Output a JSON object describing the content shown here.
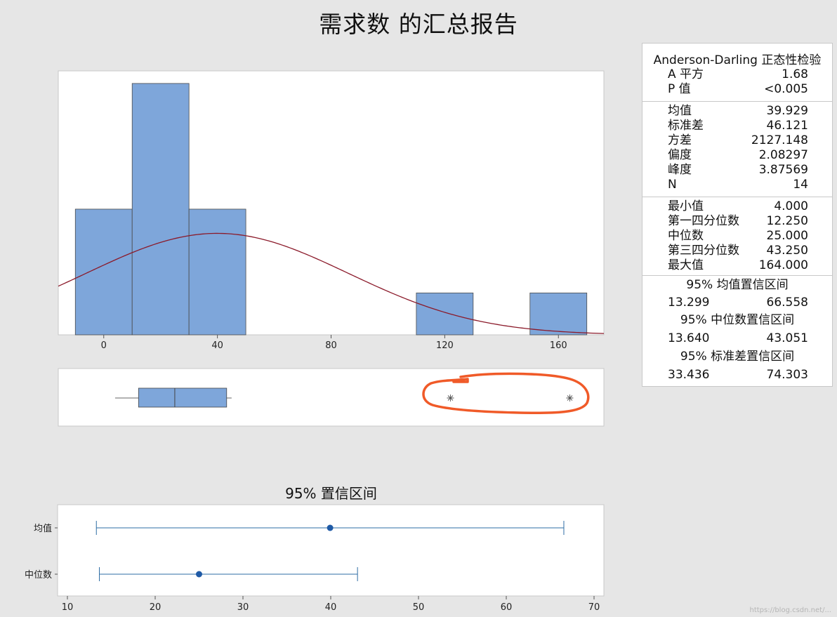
{
  "title": "需求数 的汇总报告",
  "colors": {
    "bar_fill": "#7ea6da",
    "bar_stroke": "#4a4a4a",
    "curve": "#8b1a2a",
    "ci": "#2e6da4",
    "ci_dot": "#1f5aa6",
    "annotation": "#f05a28"
  },
  "stats": {
    "anderson_title": "Anderson-Darling 正态性检验",
    "group1": [
      {
        "label": "A 平方",
        "value": "1.68"
      },
      {
        "label": "P 值",
        "value": "<0.005"
      }
    ],
    "group2": [
      {
        "label": "均值",
        "value": "39.929"
      },
      {
        "label": "标准差",
        "value": "46.121"
      },
      {
        "label": "方差",
        "value": "2127.148"
      },
      {
        "label": "偏度",
        "value": "2.08297"
      },
      {
        "label": "峰度",
        "value": "3.87569"
      },
      {
        "label": "N",
        "value": "14"
      }
    ],
    "group3": [
      {
        "label": "最小值",
        "value": "4.000"
      },
      {
        "label": "第一四分位数",
        "value": "12.250"
      },
      {
        "label": "中位数",
        "value": "25.000"
      },
      {
        "label": "第三四分位数",
        "value": "43.250"
      },
      {
        "label": "最大值",
        "value": "164.000"
      }
    ],
    "ci_mean": {
      "title": "95% 均值置信区间",
      "lo": "13.299",
      "hi": "66.558"
    },
    "ci_median": {
      "title": "95% 中位数置信区间",
      "lo": "13.640",
      "hi": "43.051"
    },
    "ci_stdev": {
      "title": "95% 标准差置信区间",
      "lo": "33.436",
      "hi": "74.303"
    }
  },
  "ci_panel_title": "95% 置信区间",
  "watermark": "https://blog.csdn.net/...",
  "chart_data": [
    {
      "type": "bar",
      "name": "histogram",
      "bins": [
        {
          "from": -10,
          "to": 10,
          "count": 3
        },
        {
          "from": 10,
          "to": 30,
          "count": 6
        },
        {
          "from": 30,
          "to": 50,
          "count": 3
        },
        {
          "from": 50,
          "to": 70,
          "count": 0
        },
        {
          "from": 70,
          "to": 90,
          "count": 0
        },
        {
          "from": 90,
          "to": 110,
          "count": 0
        },
        {
          "from": 110,
          "to": 130,
          "count": 1
        },
        {
          "from": 130,
          "to": 150,
          "count": 0
        },
        {
          "from": 150,
          "to": 170,
          "count": 1
        }
      ],
      "normal_fit": {
        "mean": 39.929,
        "stdev": 46.121,
        "n": 14,
        "bin_width": 20
      },
      "xticks": [
        0,
        40,
        80,
        120,
        160
      ],
      "xlim": [
        -16,
        176
      ],
      "ylim": [
        0,
        6.3
      ]
    },
    {
      "type": "boxplot",
      "min_whisker": 4,
      "q1": 12.25,
      "median": 25,
      "q3": 43.25,
      "max_whisker": 45,
      "outliers": [
        122,
        164
      ],
      "xlim": [
        -16,
        176
      ]
    },
    {
      "type": "interval",
      "title": "95% 置信区间",
      "intervals": [
        {
          "label": "均值",
          "estimate": 39.929,
          "lo": 13.299,
          "hi": 66.558
        },
        {
          "label": "中位数",
          "estimate": 25,
          "lo": 13.64,
          "hi": 43.051
        }
      ],
      "xticks": [
        10,
        20,
        30,
        40,
        50,
        60,
        70
      ],
      "xlim": [
        10,
        70
      ]
    }
  ]
}
